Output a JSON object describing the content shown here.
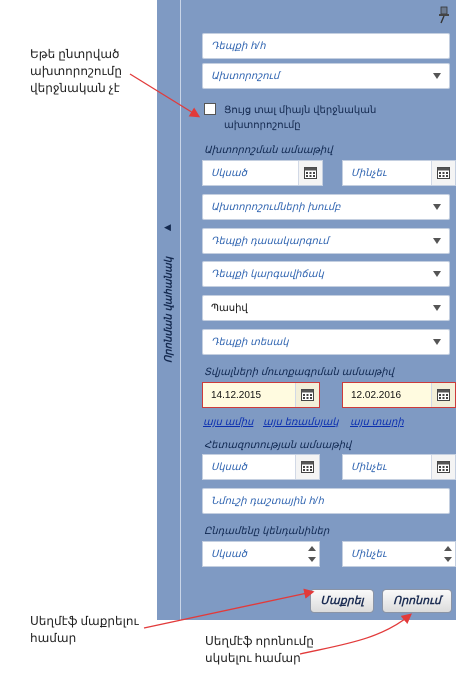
{
  "annotations": {
    "unchecked_note": "Եթե ընտրված\nախտորոշումը\nվերջնական չէ",
    "clear_note": "Սեղմէֆ մաքրելու\nհամար",
    "search_note": "Սեղմէֆ որոնումը\nսկսելու համար"
  },
  "sidebar": {
    "label": "Որոնման վահանակ"
  },
  "form": {
    "patient_id_placeholder": "Դեպքի հ/հ",
    "diagnosis_placeholder": "Ախտորոշում",
    "final_only_label": "Ցույց տալ միայն վերջնական\nախտորոշումը",
    "diagnosis_date_label": "Ախտորոշման ամսաթիվ",
    "from_placeholder": "Սկսած",
    "to_placeholder": "Մինչեւ",
    "diagnosis_group_placeholder": "Ախտորոշումների խումբ",
    "case_class_placeholder": "Դեպքի դասակարգում",
    "case_status_placeholder": "Դեպքի կարգավիճակ",
    "status_value": "Պասիվ",
    "case_type_placeholder": "Դեպքի տեսակ",
    "data_entry_date_label": "Տվյալների մուտքագրման ամսաթիվ",
    "data_entry_from": "14.12.2015",
    "data_entry_to": "12.02.2016",
    "quick_links": [
      "այս ամիս",
      "այս եռամսյակ",
      "այս տարի"
    ],
    "hospital_date_label": "Հետազոտության ամսաթիվ",
    "sample_id_placeholder": "Նմուշի դաշտային հ/հ",
    "age_range_label": "Ընդամենը կենդանիներ"
  },
  "buttons": {
    "clear": "Մաքրել",
    "search": "Որոնում"
  },
  "colors": {
    "panel": "#7f9ac3",
    "annotation_arrow": "#e23a3a",
    "active_date_border": "#cc3b3b"
  },
  "icons": [
    "pin-icon",
    "calendar-icon",
    "chevron-down-icon",
    "collapse-arrow-icon"
  ]
}
